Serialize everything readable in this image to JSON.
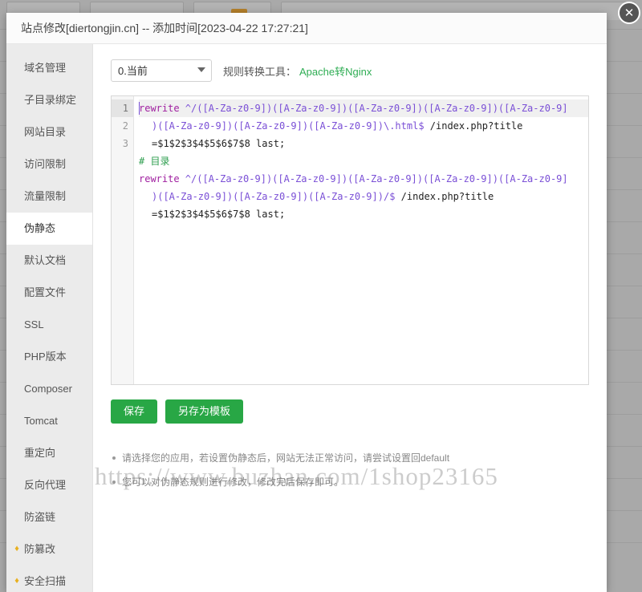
{
  "window": {
    "title": "站点修改[diertongjin.cn] -- 添加时间[2023-04-22 17:27:21]",
    "close_label": "✕"
  },
  "sidebar": {
    "items": [
      {
        "label": "域名管理",
        "icon": "",
        "active": false
      },
      {
        "label": "子目录绑定",
        "icon": "",
        "active": false
      },
      {
        "label": "网站目录",
        "icon": "",
        "active": false
      },
      {
        "label": "访问限制",
        "icon": "",
        "active": false
      },
      {
        "label": "流量限制",
        "icon": "",
        "active": false
      },
      {
        "label": "伪静态",
        "icon": "",
        "active": true
      },
      {
        "label": "默认文档",
        "icon": "",
        "active": false
      },
      {
        "label": "配置文件",
        "icon": "",
        "active": false
      },
      {
        "label": "SSL",
        "icon": "",
        "active": false
      },
      {
        "label": "PHP版本",
        "icon": "",
        "active": false
      },
      {
        "label": "Composer",
        "icon": "",
        "active": false
      },
      {
        "label": "Tomcat",
        "icon": "",
        "active": false
      },
      {
        "label": "重定向",
        "icon": "",
        "active": false
      },
      {
        "label": "反向代理",
        "icon": "",
        "active": false
      },
      {
        "label": "防盗链",
        "icon": "",
        "active": false
      },
      {
        "label": "防篡改",
        "icon": "♦",
        "active": false
      },
      {
        "label": "安全扫描",
        "icon": "♦",
        "active": false
      }
    ]
  },
  "toolbar": {
    "select_value": "0.当前",
    "select_options": [
      "0.当前"
    ],
    "converter_label": "规则转换工具：",
    "converter_link": "Apache转Nginx"
  },
  "editor": {
    "line_numbers": [
      "1",
      "2",
      "3"
    ],
    "lines": [
      {
        "number": "1",
        "active": true,
        "segments": [
          {
            "text": "rewrite ",
            "type": "keyword"
          },
          {
            "text": "^/([A-Za-z0-9])([A-Za-z0-9])([A-Za-z0-9])([A-Za-z0-9])([A-Za-z0-9]",
            "type": "regex"
          }
        ]
      },
      {
        "number": "",
        "continuation": true,
        "segments": [
          {
            "text": ")([A-Za-z0-9])([A-Za-z0-9])([A-Za-z0-9])\\.html$",
            "type": "regex"
          },
          {
            "text": " /index.php?title",
            "type": "plain"
          }
        ]
      },
      {
        "number": "",
        "continuation": true,
        "segments": [
          {
            "text": "=$1$2$3$4$5$6$7$8 last;",
            "type": "plain"
          }
        ]
      },
      {
        "number": "2",
        "active": false,
        "segments": [
          {
            "text": "# 目录",
            "type": "comment"
          }
        ]
      },
      {
        "number": "3",
        "active": false,
        "segments": [
          {
            "text": "rewrite ",
            "type": "keyword"
          },
          {
            "text": "^/([A-Za-z0-9])([A-Za-z0-9])([A-Za-z0-9])([A-Za-z0-9])([A-Za-z0-9]",
            "type": "regex"
          }
        ]
      },
      {
        "number": "",
        "continuation": true,
        "segments": [
          {
            "text": ")([A-Za-z0-9])([A-Za-z0-9])([A-Za-z0-9])/$",
            "type": "regex"
          },
          {
            "text": " /index.php?title",
            "type": "plain"
          }
        ]
      },
      {
        "number": "",
        "continuation": true,
        "segments": [
          {
            "text": "=$1$2$3$4$5$6$7$8 last;",
            "type": "plain"
          }
        ]
      }
    ]
  },
  "buttons": {
    "save": "保存",
    "save_as_template": "另存为模板"
  },
  "hints": [
    "请选择您的应用，若设置伪静态后，网站无法正常访问，请尝试设置回default",
    "您可以对伪静态规则进行修改，修改完后保存即可。"
  ],
  "watermark": {
    "text": "https://www.buzhan.com/1shop23165"
  },
  "colors": {
    "accent_green": "#28a745",
    "link_green": "#2fad54",
    "keyword": "#a020a0",
    "regex": "#7a4fd6",
    "comment": "#2e9e4f",
    "sidebar_bg": "#ebebeb",
    "vip_icon": "#e8b020"
  }
}
